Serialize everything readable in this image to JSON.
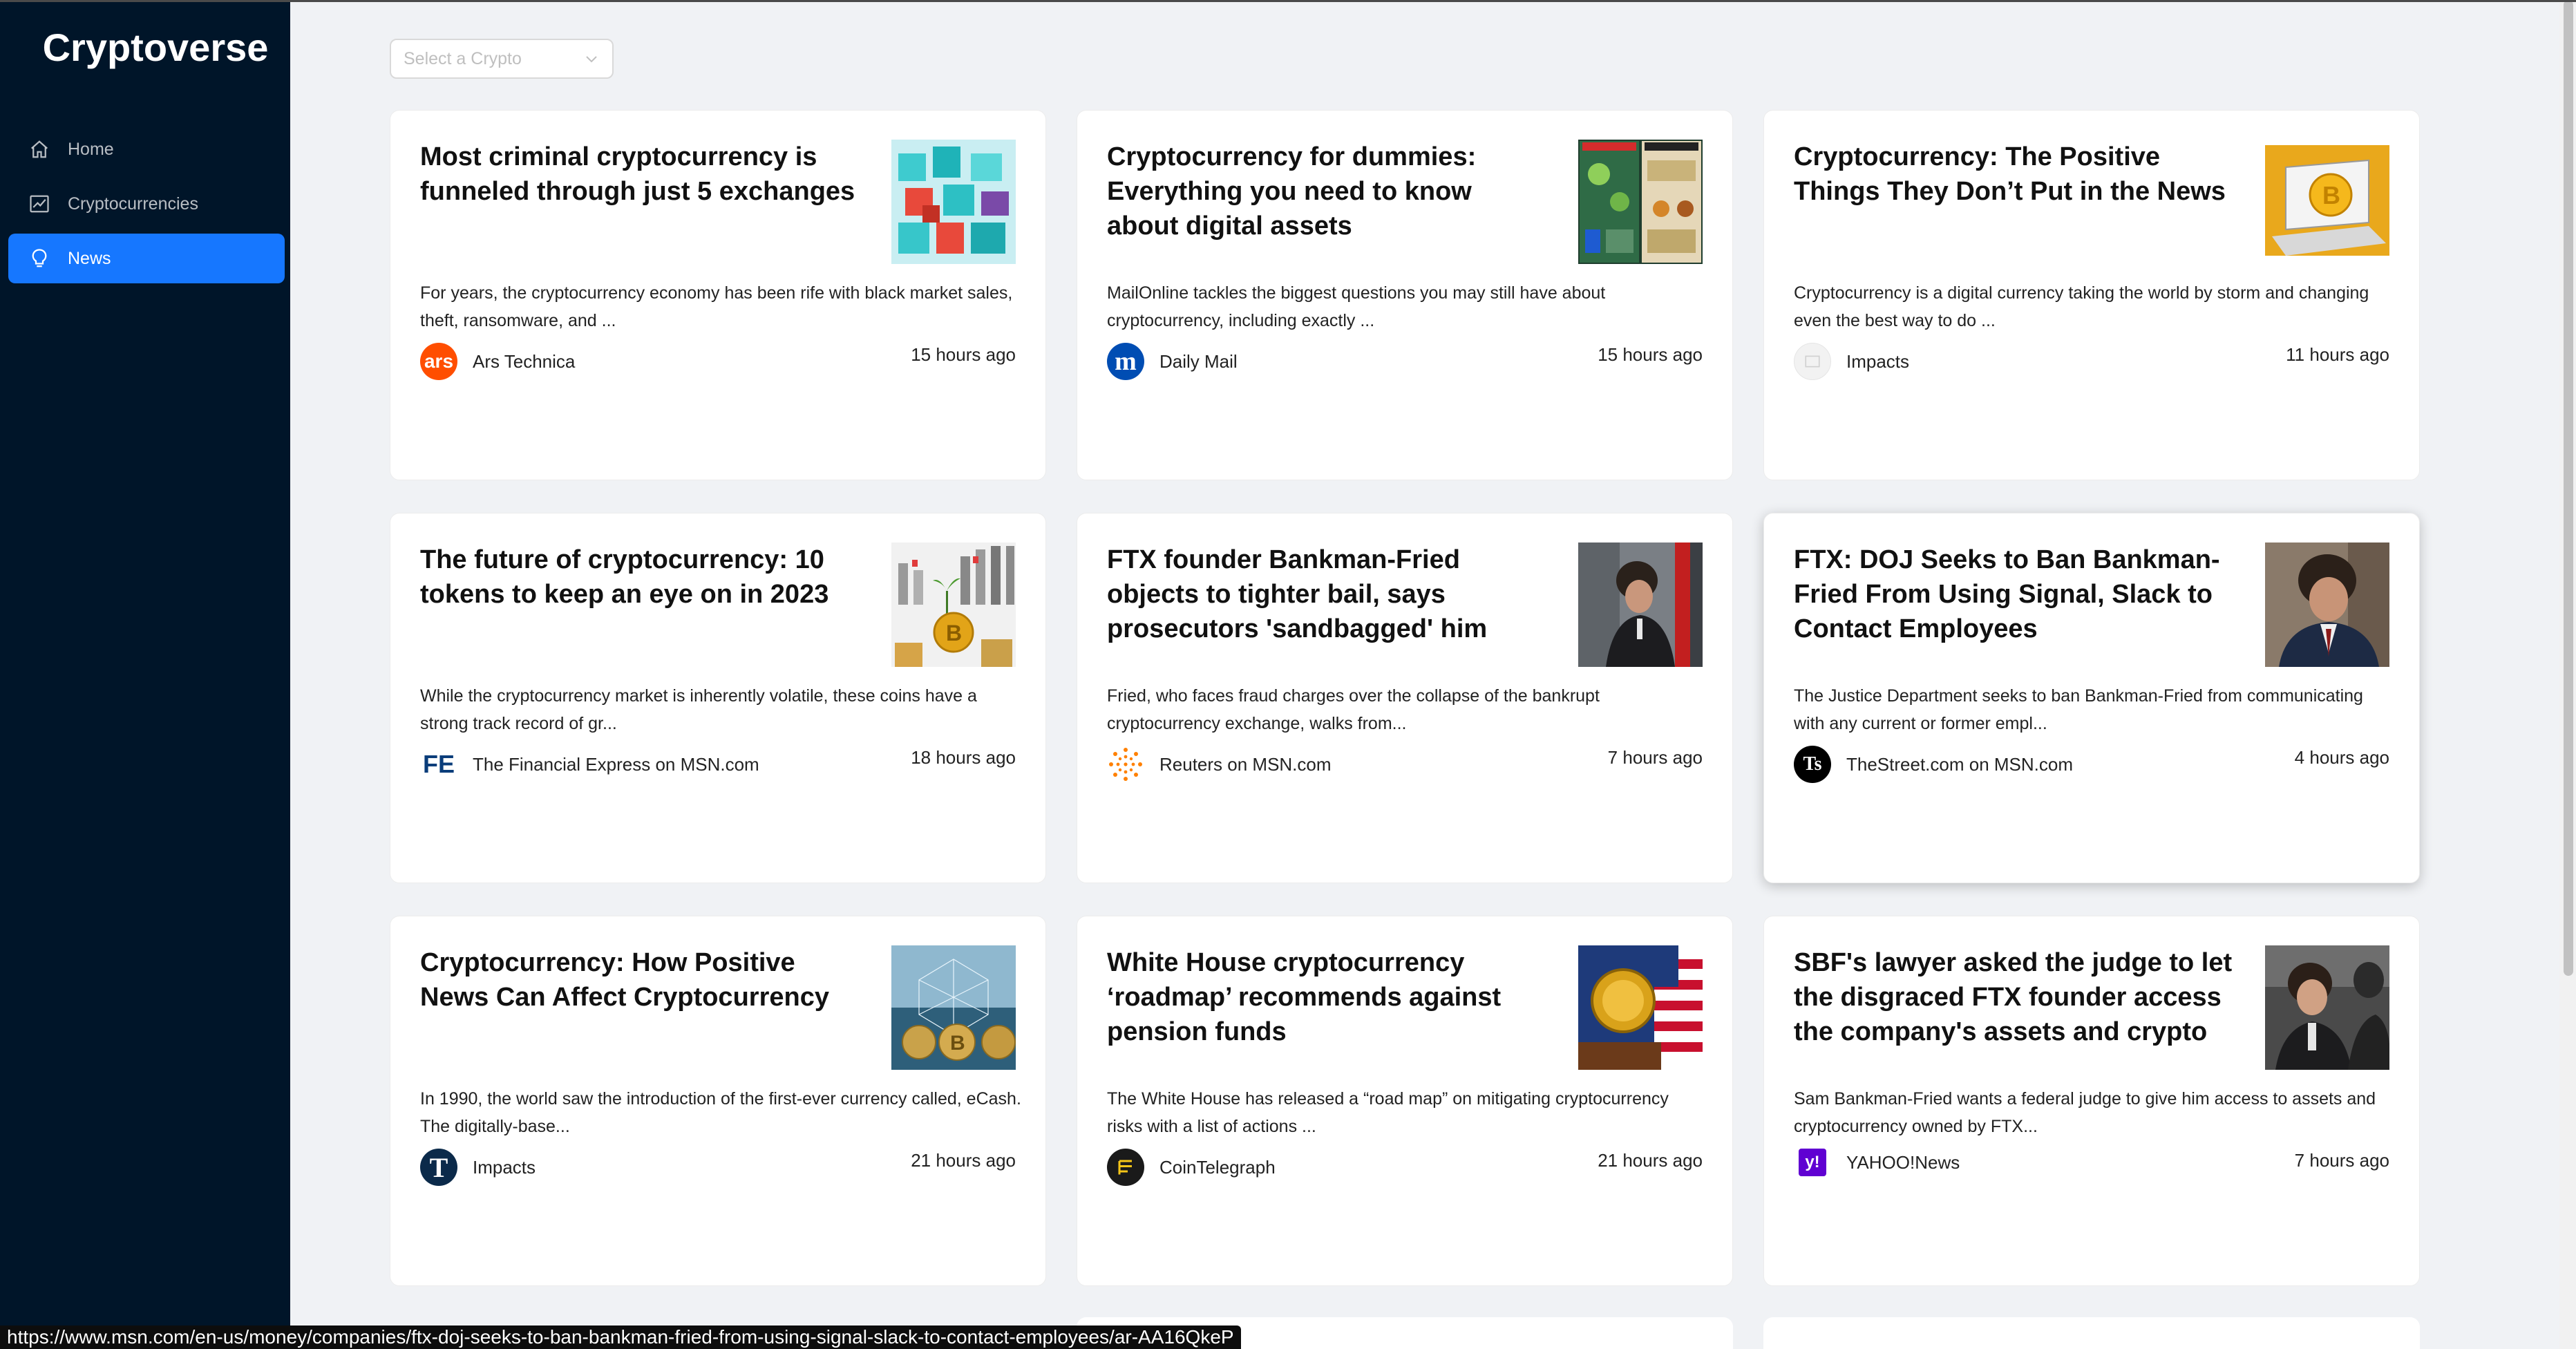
{
  "app": {
    "title": "Cryptoverse"
  },
  "sidebar": {
    "items": [
      {
        "label": "Home",
        "icon": "home-icon",
        "active": false
      },
      {
        "label": "Cryptocurrencies",
        "icon": "chart-icon",
        "active": false
      },
      {
        "label": "News",
        "icon": "bulb-icon",
        "active": true
      }
    ]
  },
  "select": {
    "placeholder": "Select a Crypto"
  },
  "news": [
    {
      "title": "Most criminal cryptocurrency is funneled through just 5 exchanges",
      "description": "For years, the cryptocurrency economy has been rife with black market sales, theft, ransomware, and ...",
      "provider": "Ars Technica",
      "provider_logo_text": "ars",
      "provider_color": "#ff4e00",
      "time": "15 hours ago",
      "thumb": "cubes-image"
    },
    {
      "title": "Cryptocurrency for dummies: Everything you need to know about digital assets",
      "description": "MailOnline tackles the biggest questions you may still have about cryptocurrency, including exactly ...",
      "provider": "Daily Mail",
      "provider_logo_text": "m",
      "provider_color": "#004db3",
      "time": "15 hours ago",
      "thumb": "infographic-image"
    },
    {
      "title": "Cryptocurrency: The Positive Things They Don’t Put in the News",
      "description": "Cryptocurrency is a digital currency taking the world by storm and changing even the best way to do ...",
      "provider": "Impacts",
      "provider_logo_text": "",
      "provider_color": "#f2f2f2",
      "time": "11 hours ago",
      "thumb": "laptop-bitcoin-image"
    },
    {
      "title": "The future of cryptocurrency: 10 tokens to keep an eye on in 2023",
      "description": "While the cryptocurrency market is inherently volatile, these coins have a strong track record of gr...",
      "provider": "The Financial Express on MSN.com",
      "provider_logo_text": "FE",
      "provider_color": "#ffffff",
      "time": "18 hours ago",
      "thumb": "coin-stacks-image"
    },
    {
      "title": "FTX founder Bankman-Fried objects to tighter bail, says prosecutors 'sandbagged' him",
      "description": "Fried, who faces fraud charges over the collapse of the bankrupt cryptocurrency exchange, walks from...",
      "provider": "Reuters on MSN.com",
      "provider_logo_text": "",
      "provider_color": "#ff8000",
      "time": "7 hours ago",
      "thumb": "person-street-image"
    },
    {
      "title": "FTX: DOJ Seeks to Ban Bankman-Fried From Using Signal, Slack to Contact Employees",
      "description": "The Justice Department seeks to ban Bankman-Fried from communicating with any current or former empl...",
      "provider": "TheStreet.com on MSN.com",
      "provider_logo_text": "Ts",
      "provider_color": "#000000",
      "time": "4 hours ago",
      "thumb": "person-suit-image"
    },
    {
      "title": "Cryptocurrency: How Positive News Can Affect Cryptocurrency",
      "description": "In 1990, the world saw the introduction of the first-ever currency called, eCash. The digitally-base...",
      "provider": "Impacts",
      "provider_logo_text": "T",
      "provider_color": "#0b2a4a",
      "time": "21 hours ago",
      "thumb": "bitcoin-network-image"
    },
    {
      "title": "White House cryptocurrency ‘roadmap’ recommends against pension funds",
      "description": "The White House has released a “road map” on mitigating cryptocurrency risks with a list of actions ...",
      "provider": "CoinTelegraph",
      "provider_logo_text": "",
      "provider_color": "#1a1a1a",
      "time": "21 hours ago",
      "thumb": "flag-coin-image"
    },
    {
      "title": "SBF's lawyer asked the judge to let the disgraced FTX founder access the company's assets and crypto",
      "description": "Sam Bankman-Fried wants a federal judge to give him access to assets and cryptocurrency owned by FTX...",
      "provider": "YAHOO!News",
      "provider_logo_text": "y!",
      "provider_color": "#6001d2",
      "time": "7 hours ago",
      "thumb": "crowd-person-image"
    }
  ],
  "status_bar": {
    "url": "https://www.msn.com/en-us/money/companies/ftx-doj-seeks-to-ban-bankman-fried-from-using-signal-slack-to-contact-employees/ar-AA16QkeP"
  }
}
